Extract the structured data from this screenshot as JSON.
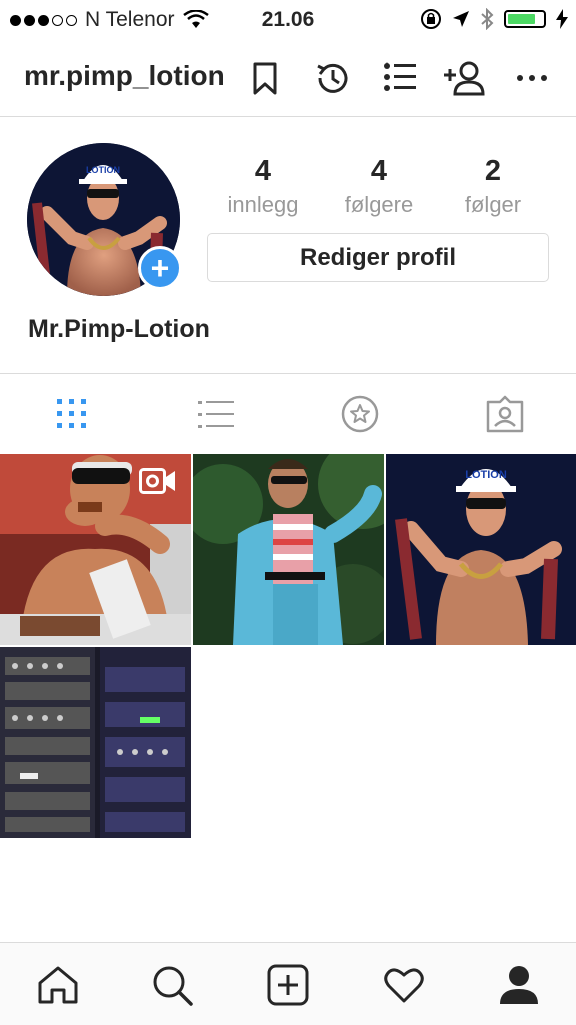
{
  "status_bar": {
    "carrier": "N Telenor",
    "time": "21.06",
    "battery_color": "#4cd964"
  },
  "header": {
    "username": "mr.pimp_lotion",
    "icons": [
      "bookmark-icon",
      "history-icon",
      "discover-people-list-icon",
      "add-person-icon",
      "more-icon"
    ]
  },
  "profile": {
    "avatar_cap_text": "LOTION",
    "stats": [
      {
        "value": "4",
        "label": "innlegg"
      },
      {
        "value": "4",
        "label": "følgere"
      },
      {
        "value": "2",
        "label": "følger"
      }
    ],
    "edit_button": "Rediger profil",
    "full_name": "Mr.Pimp-Lotion"
  },
  "tabs": [
    {
      "name": "grid-view-tab",
      "icon": "grid-icon",
      "active": true
    },
    {
      "name": "list-view-tab",
      "icon": "list-icon",
      "active": false
    },
    {
      "name": "saved-tab",
      "icon": "star-icon",
      "active": false
    },
    {
      "name": "tagged-tab",
      "icon": "tagged-person-icon",
      "active": false
    }
  ],
  "posts": [
    {
      "desc": "man eating with sunglasses",
      "video": true
    },
    {
      "desc": "person in blue suit"
    },
    {
      "desc": "man with lotion cap holding meat"
    },
    {
      "desc": "studio audio rack equipment"
    }
  ],
  "post_cap_text": "LOTION",
  "bottom_nav": [
    "home-icon",
    "search-icon",
    "new-post-icon",
    "activity-heart-icon",
    "profile-icon"
  ],
  "colors": {
    "accent": "#3897f0",
    "text": "#262626",
    "secondary": "#999999",
    "border": "#dbdbdb"
  }
}
